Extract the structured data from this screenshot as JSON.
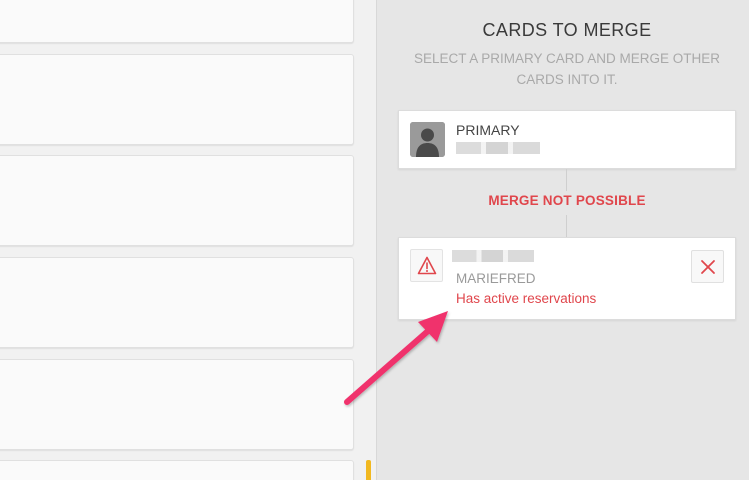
{
  "merge_panel": {
    "title": "CARDS TO MERGE",
    "subtitle": "SELECT A PRIMARY CARD AND MERGE OTHER CARDS INTO IT.",
    "primary_card": {
      "label": "PRIMARY",
      "icon": "person-avatar-icon"
    },
    "merge_status": "MERGE NOT POSSIBLE",
    "merge_card": {
      "icon": "warning-triangle-icon",
      "subtitle": "MARIEFRED",
      "error": "Has active reservations",
      "remove_icon": "close-icon"
    }
  },
  "colors": {
    "error_red": "#e0464c",
    "arrow_pink": "#f0306c",
    "scroll_accent": "#f1b820"
  }
}
